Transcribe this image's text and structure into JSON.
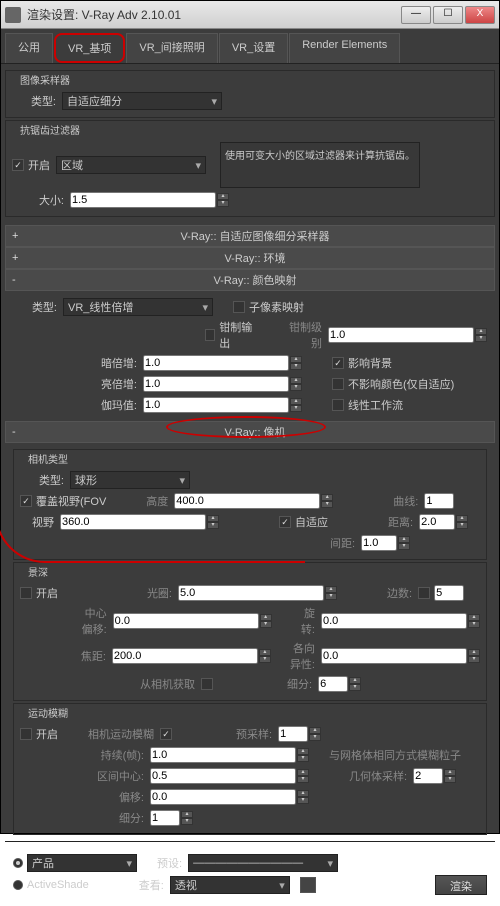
{
  "title": "渲染设置: V-Ray Adv 2.10.01",
  "win": {
    "min": "—",
    "max": "☐",
    "close": "X"
  },
  "tabs": {
    "t0": "公用",
    "t1": "VR_基项",
    "t2": "VR_间接照明",
    "t3": "VR_设置",
    "t4": "Render Elements"
  },
  "imgSampler": {
    "title": "图像采样器",
    "typeLbl": "类型:",
    "type": "自适应细分"
  },
  "antialias": {
    "title": "抗锯齿过滤器",
    "enableLbl": "开启",
    "enable": "✓",
    "filter": "区域",
    "sizeLbl": "大小:",
    "size": "1.5",
    "info": "使用可变大小的区域过滤器来计算抗锯齿。"
  },
  "rollups": {
    "adaptive": "V-Ray:: 自适应图像细分采样器",
    "env": "V-Ray:: 环境",
    "color": "V-Ray:: 颜色映射",
    "camera": "V-Ray:: 像机"
  },
  "colormap": {
    "typeLbl": "类型:",
    "type": "VR_线性倍增",
    "c1": "子像素映射",
    "c2": "钳制输出",
    "c2vLbl": "钳制级别",
    "c2v": "1.0",
    "darkLbl": "暗倍增:",
    "dark": "1.0",
    "c3": "影响背景",
    "brightLbl": "亮倍增:",
    "bright": "1.0",
    "c4": "不影响颜色(仅自适应)",
    "gammaLbl": "伽玛值:",
    "gamma": "1.0",
    "c5": "线性工作流"
  },
  "camera": {
    "typeGroup": "相机类型",
    "typeLbl": "类型:",
    "type": "球形",
    "fovChkLbl": "覆盖视野(FOV",
    "fovChk": "✓",
    "heightLbl": "高度",
    "height": "400.0",
    "curveLbl": "曲线:",
    "curve": "1",
    "viewLbl": "视野",
    "view": "360.0",
    "adaptLbl": "自适应",
    "adaptChk": "✓",
    "distLbl": "距离:",
    "dist": "2.0",
    "interLbl": "间距:",
    "inter": "1.0",
    "dofGroup": "景深",
    "enableLbl": "开启",
    "apLbl": "光圈:",
    "ap": "5.0",
    "sidesLbl": "边数:",
    "sides": "5",
    "centerLbl": "中心偏移:",
    "center": "0.0",
    "rotLbl": "旋转:",
    "rot": "0.0",
    "focalLbl": "焦距:",
    "focal": "200.0",
    "anisLbl": "各向异性:",
    "anis": "0.0",
    "fromCamLbl": "从相机获取",
    "subdivLbl": "细分:",
    "subdiv": "6",
    "mbGroup": "运动模糊",
    "camMbLbl": "相机运动模糊",
    "camMbChk": "✓",
    "presampLbl": "预采样:",
    "presamp": "1",
    "durLbl": "持续(帧):",
    "dur": "1.0",
    "meshLbl": "与网格体相同方式模糊粒子",
    "intCenterLbl": "区间中心:",
    "intCenter": "0.5",
    "geoSampLbl": "几何体采样:",
    "geoSamp": "2",
    "biasLbl": "偏移:",
    "bias": "0.0",
    "subdiv2Lbl": "细分:",
    "subdiv2": "1"
  },
  "footer": {
    "prodLbl": "产品",
    "presetLbl": "预设:",
    "preset": "——————————",
    "asLbl": "ActiveShade",
    "viewLbl": "查看:",
    "view": "透视",
    "renderBtn": "渲染"
  },
  "plus": "+",
  "minus": "-"
}
